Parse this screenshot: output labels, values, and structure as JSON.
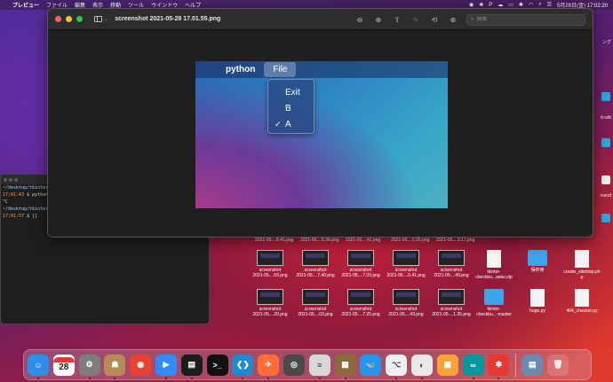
{
  "menubar": {
    "app": "プレビュー",
    "items": [
      "ファイル",
      "編集",
      "表示",
      "移動",
      "ツール",
      "ウインドウ",
      "ヘルプ"
    ],
    "datetime": "5月28日(金) 17:02:20"
  },
  "terminal": {
    "lines": [
      {
        "path": "~/desktop/tkinter-c",
        "rest": ""
      },
      {
        "path": "",
        "time": "17:01:43",
        "rest": " $ python m"
      },
      {
        "path": "",
        "time": "",
        "rest": "^C"
      },
      {
        "path": "~/desktop/tkinter-c",
        "rest": ""
      },
      {
        "path": "",
        "time": "17:01:57",
        "rest": " $ []"
      }
    ]
  },
  "edge_labels": [
    "ング",
    "d-sdk",
    "mand"
  ],
  "preview": {
    "title": "screenshot 2021-05-28 17.01.55.png",
    "search_placeholder": "検索",
    "screenshot": {
      "app_name": "python",
      "menu": "File",
      "menu_items": [
        {
          "label": "Exit",
          "checked": false
        },
        {
          "label": "B",
          "checked": false
        },
        {
          "label": "A",
          "checked": true
        }
      ],
      "check_glyph": "✓"
    }
  },
  "desktop": {
    "top_labels": [
      "2021-05....8.41.png",
      "2021-05....5.36.png",
      "2021-05....42.png",
      "2021-05....0.25.png",
      "2021-05....3.17.png"
    ],
    "row1": [
      {
        "name": "screenshot",
        "sub": "2021-05....59.png",
        "kind": "thumb"
      },
      {
        "name": "screenshot",
        "sub": "2021-05....7.40.png",
        "kind": "thumb"
      },
      {
        "name": "screenshot",
        "sub": "2021-05....7.03.png",
        "kind": "thumb"
      },
      {
        "name": "screenshot",
        "sub": "2021-05....0.41.png",
        "kind": "thumb"
      },
      {
        "name": "screenshot",
        "sub": "2021-05....49.png",
        "kind": "thumb"
      },
      {
        "name": "tkinter-",
        "sub": "checkbu...aster.zip",
        "kind": "doc"
      },
      {
        "name": "保存用",
        "sub": "",
        "kind": "folder"
      },
      {
        "name": "create_sitemap.ph",
        "sub": "p",
        "kind": "doc"
      }
    ],
    "row2": [
      {
        "name": "screenshot",
        "sub": "2021-05....20.png",
        "kind": "thumb"
      },
      {
        "name": "screenshot",
        "sub": "2021-05....03.png",
        "kind": "thumb"
      },
      {
        "name": "screenshot",
        "sub": "2021-05....7.25.png",
        "kind": "thumb"
      },
      {
        "name": "screenshot",
        "sub": "2021-05....43.png",
        "kind": "thumb"
      },
      {
        "name": "screenshot",
        "sub": "2021-05....1.35.png",
        "kind": "thumb"
      },
      {
        "name": "tkinter-",
        "sub": "checkbu...-master",
        "kind": "folder"
      },
      {
        "name": "hoge.py",
        "sub": "",
        "kind": "doc"
      },
      {
        "name": "404_checker.py",
        "sub": "",
        "kind": "doc"
      }
    ]
  },
  "dock": {
    "calendar_day": "28",
    "apps": [
      {
        "name": "finder",
        "color": "#2c8fe8",
        "glyph": "☺"
      },
      {
        "name": "calendar",
        "color": "#ffffff",
        "glyph": ""
      },
      {
        "name": "system-preferences",
        "color": "#7d7d7d",
        "glyph": "⚙"
      },
      {
        "name": "contacts",
        "color": "#b98a56",
        "glyph": "☗"
      },
      {
        "name": "chrome",
        "color": "#e94235",
        "glyph": "◉"
      },
      {
        "name": "zoom",
        "color": "#2d8cff",
        "glyph": "▶"
      },
      {
        "name": "activity-monitor",
        "color": "#1c1c1c",
        "glyph": "▤"
      },
      {
        "name": "terminal",
        "color": "#111111",
        "glyph": ">_"
      },
      {
        "name": "vscode",
        "color": "#1f8ad2",
        "glyph": "❮❯"
      },
      {
        "name": "postman",
        "color": "#ff6c37",
        "glyph": "✈"
      },
      {
        "name": "proxyman",
        "color": "#4a4a4a",
        "glyph": "◎"
      },
      {
        "name": "sequel",
        "color": "#d8d8d8",
        "glyph": "≡"
      },
      {
        "name": "archive",
        "color": "#8a6a3a",
        "glyph": "▦"
      },
      {
        "name": "docker",
        "color": "#2496ed",
        "glyph": "🐳"
      },
      {
        "name": "sourcetree",
        "color": "#f0f0f0",
        "glyph": "⌥"
      },
      {
        "name": "pencil-app",
        "color": "#e8e8e8",
        "glyph": "◐"
      },
      {
        "name": "preview",
        "color": "#f6a23a",
        "glyph": "▣"
      },
      {
        "name": "arduino",
        "color": "#00979d",
        "glyph": "∞"
      },
      {
        "name": "clock",
        "color": "#e63a30",
        "glyph": "✱"
      }
    ]
  }
}
